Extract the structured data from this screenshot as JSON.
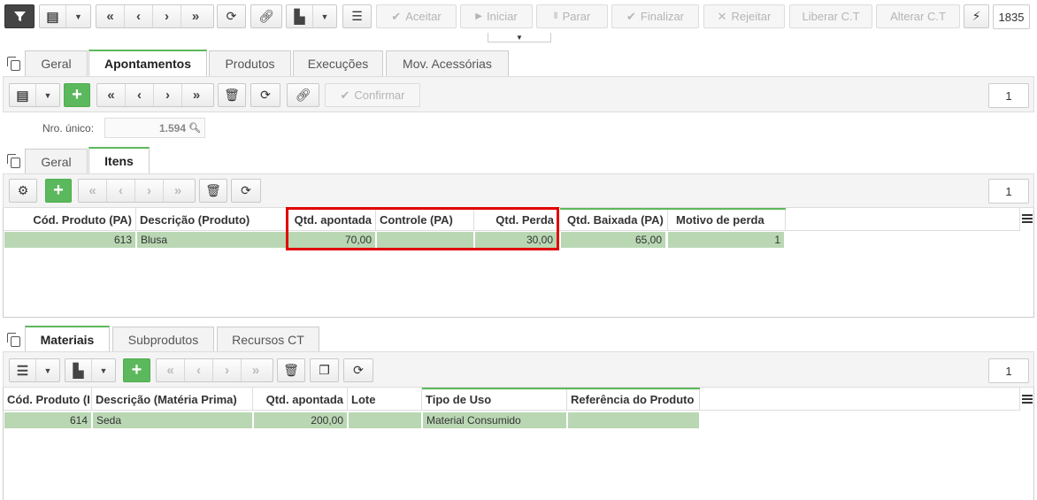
{
  "toolbar": {
    "aceitar": "Aceitar",
    "iniciar": "Iniciar",
    "parar": "Parar",
    "finalizar": "Finalizar",
    "rejeitar": "Rejeitar",
    "liberar": "Liberar C.T",
    "alterar": "Alterar C.T",
    "page": "1835"
  },
  "top_tabs": [
    "Geral",
    "Apontamentos",
    "Produtos",
    "Execuções",
    "Mov. Acessórias"
  ],
  "apont_bar": {
    "confirmar": "Confirmar",
    "page": "1"
  },
  "nro_unico": {
    "label": "Nro. único:",
    "value": "1.594"
  },
  "sub_tabs": [
    "Geral",
    "Itens"
  ],
  "itens_bar": {
    "page": "1"
  },
  "itens_grid": {
    "columns": [
      "Cód. Produto (PA)",
      "Descrição (Produto)",
      "Qtd. apontada",
      "Controle (PA)",
      "Qtd. Perda",
      "Qtd. Baixada (PA)",
      "Motivo de perda"
    ],
    "row": [
      "613",
      "Blusa",
      "70,00",
      "",
      "30,00",
      "65,00",
      "1"
    ]
  },
  "bottom_tabs": [
    "Materiais",
    "Subprodutos",
    "Recursos CT"
  ],
  "mat_bar": {
    "page": "1"
  },
  "mat_grid": {
    "columns": [
      "Cód. Produto (I",
      "Descrição (Matéria Prima)",
      "Qtd. apontada",
      "Lote",
      "Tipo de Uso",
      "Referência do Produto"
    ],
    "row": [
      "614",
      "Seda",
      "200,00",
      "",
      "Material Consumido",
      ""
    ]
  },
  "colors": {
    "accent": "#5cb85c",
    "row": "#b9d7b3",
    "highlight": "#e00000"
  }
}
